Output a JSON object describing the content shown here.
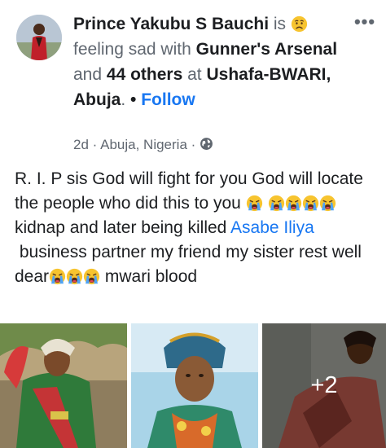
{
  "post": {
    "author": "Prince Yakubu S Bauchi",
    "is_word": "is",
    "feeling_text": "feeling sad with",
    "tagged_1": "Gunner's Arsenal",
    "and_word": "and",
    "tagged_others": "44 others",
    "at_word": "at",
    "location": "Ushafa-BWARI, Abuja",
    "period": ".",
    "bullet": "•",
    "follow_label": "Follow",
    "time": "2d",
    "place": "Abuja, Nigeria",
    "meta_sep": "·",
    "more_label": "•••",
    "text_part1": "R. I. P sis God will fight for you God will locate the people who did this to you",
    "text_part2": "kidnap and later being killed",
    "mention": "Asabe Iliya",
    "text_part3": "business partner my friend my sister rest well dear",
    "text_part4": "mwari blood"
  },
  "icons": {
    "feeling": "sad-face-icon",
    "crying": "loudly-crying-face-icon",
    "privacy": "globe-icon"
  },
  "photos": {
    "extra_count": "+2"
  },
  "colors": {
    "link_blue": "#1877f2",
    "text": "#1c1e21",
    "secondary": "#606770"
  }
}
